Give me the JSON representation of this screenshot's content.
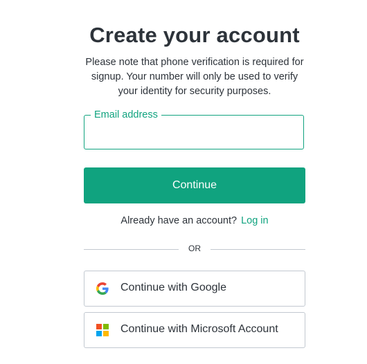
{
  "header": {
    "title": "Create your account",
    "subtitle": "Please note that phone verification is required for signup. Your number will only be used to verify your identity for security purposes."
  },
  "email": {
    "label": "Email address",
    "value": "",
    "placeholder": ""
  },
  "continue_button": {
    "label": "Continue"
  },
  "login": {
    "prompt": "Already have an account?",
    "link_label": "Log in"
  },
  "divider": {
    "text": "OR"
  },
  "social": {
    "google": {
      "label": "Continue with Google",
      "icon": "google-icon"
    },
    "microsoft": {
      "label": "Continue with Microsoft Account",
      "icon": "microsoft-icon"
    }
  },
  "colors": {
    "accent": "#10a37f",
    "text": "#2d333a",
    "border": "#c2c8d0"
  }
}
